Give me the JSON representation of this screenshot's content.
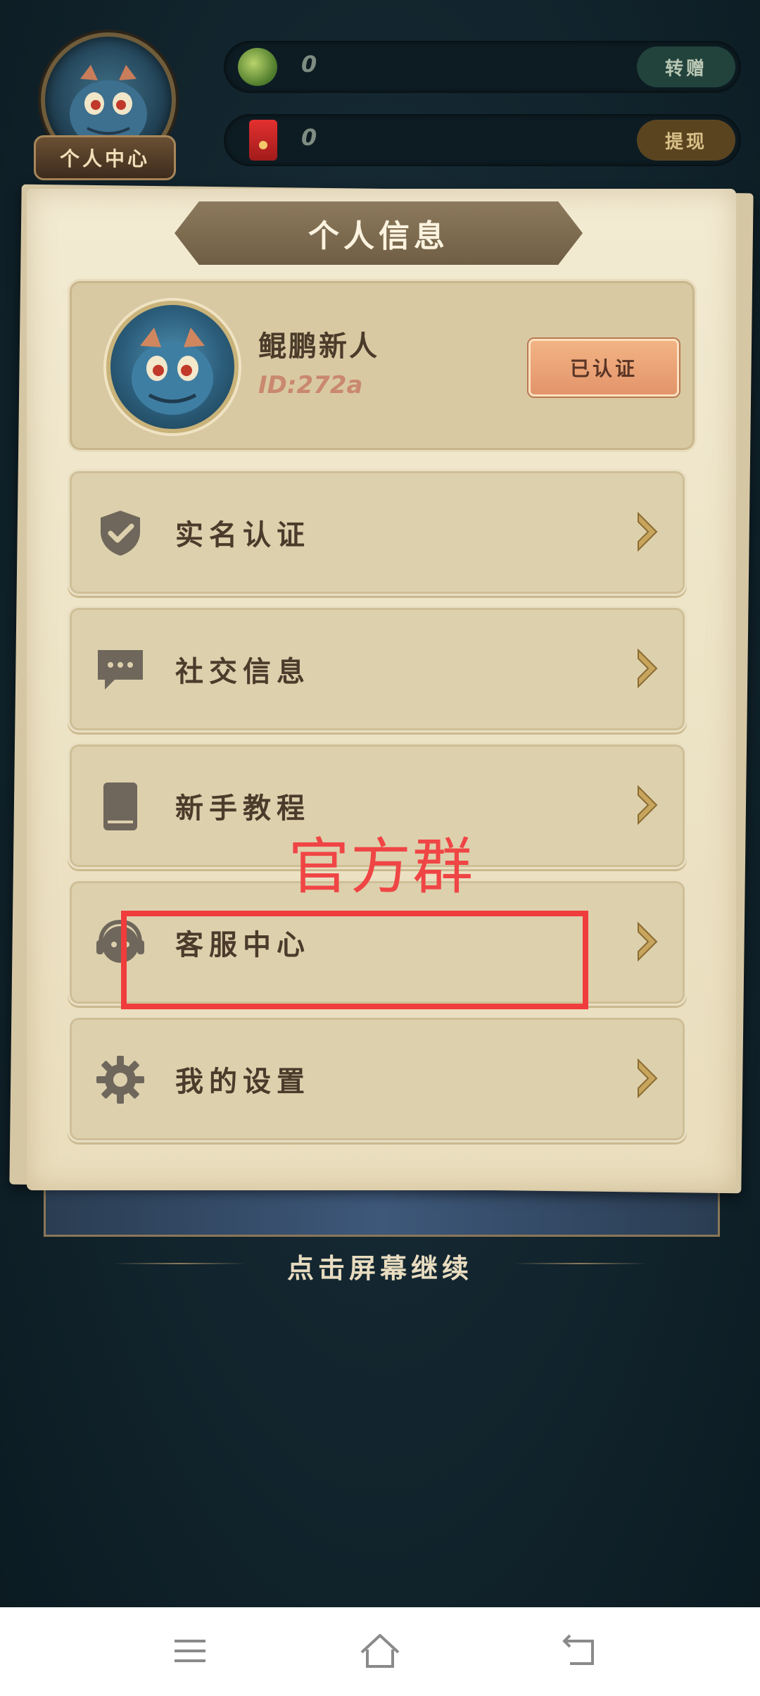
{
  "hud": {
    "avatar_label": "个人中心",
    "currencies": [
      {
        "value": "0",
        "button": "转赠",
        "icon": "coin-icon"
      },
      {
        "value": "0",
        "button": "提现",
        "icon": "red-packet-icon"
      }
    ]
  },
  "panel": {
    "title": "个人信息",
    "profile": {
      "name": "鲲鹏新人",
      "id": "ID:272a",
      "badge": "已认证"
    },
    "menu": [
      {
        "label": "实名认证",
        "icon": "shield-check-icon"
      },
      {
        "label": "社交信息",
        "icon": "chat-bubble-icon"
      },
      {
        "label": "新手教程",
        "icon": "book-icon"
      },
      {
        "label": "客服中心",
        "icon": "headset-icon"
      },
      {
        "label": "我的设置",
        "icon": "gear-icon"
      }
    ]
  },
  "annotation": {
    "text": "官方群",
    "color": "#f03c3c"
  },
  "continue_hint": "点击屏幕继续",
  "navbar": {
    "buttons": [
      "menu-icon",
      "home-icon",
      "back-icon"
    ]
  }
}
